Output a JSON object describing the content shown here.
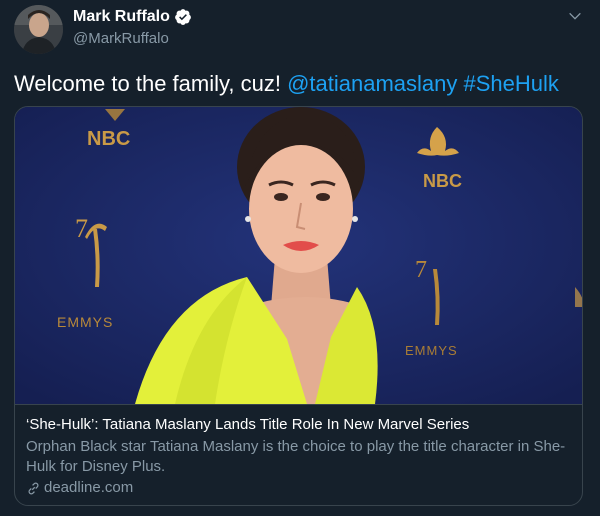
{
  "author": {
    "display_name": "Mark Ruffalo",
    "handle": "@MarkRuffalo",
    "verified": true
  },
  "tweet": {
    "text": "Welcome to the family, cuz! ",
    "mention": "@tatianamaslany",
    "hashtag": "#SheHulk"
  },
  "card": {
    "title": "‘She-Hulk’: Tatiana Maslany Lands Title Role In New Marvel Series",
    "description": "Orphan Black star Tatiana Maslany is the choice to play the title character in She-Hulk for Disney Plus.",
    "domain": "deadline.com",
    "backdrop_logos": [
      "NBC",
      "EMMYS",
      "NBC",
      "EMMYS"
    ]
  },
  "colors": {
    "background": "#15202b",
    "link": "#1da1f2",
    "secondary_text": "#8899a6",
    "border": "#38444d",
    "backdrop": "#1c2a66",
    "dress": "#e3f03a"
  }
}
